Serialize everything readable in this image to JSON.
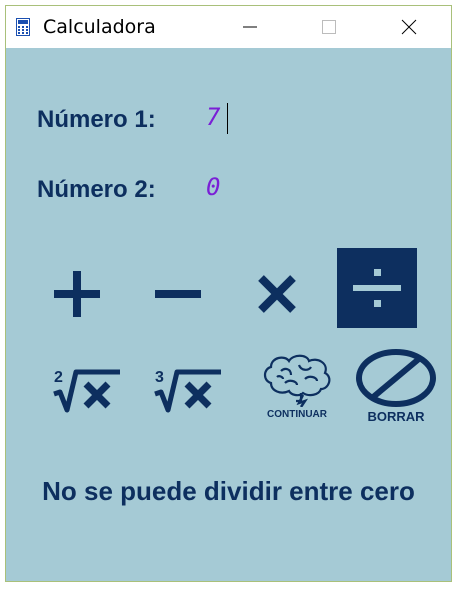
{
  "window": {
    "title": "Calculadora"
  },
  "form": {
    "number1_label": "Número 1:",
    "number1_value": "7",
    "number2_label": "Número 2:",
    "number2_value": "0"
  },
  "buttons": {
    "add": "add-icon",
    "subtract": "minus-icon",
    "multiply": "multiply-icon",
    "divide": "divide-icon",
    "sqrt2": "square-root-icon",
    "sqrt3": "cube-root-icon",
    "continue_label": "CONTINUAR",
    "clear_label": "BORRAR"
  },
  "colors": {
    "background": "#a5cad5",
    "accent": "#0d2f5f",
    "digits": "#7a1fd6"
  },
  "status": {
    "message": "No se puede dividir entre cero"
  }
}
